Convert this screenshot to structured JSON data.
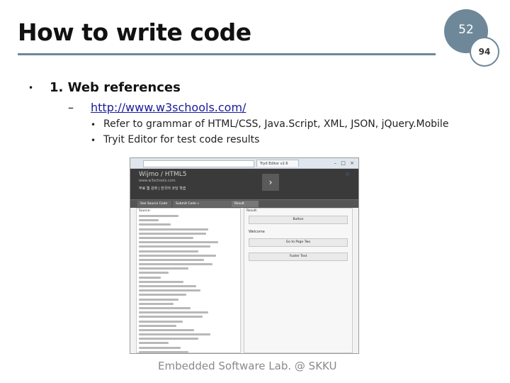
{
  "slide": {
    "title": "How to write code",
    "page_number": "52",
    "total_pages": "94",
    "footer": "Embedded Software Lab. @ SKKU"
  },
  "bullets": {
    "level1_marker": "•",
    "level1": "1. Web references",
    "level2_marker": "–",
    "level2_link": "http://www.w3schools.com/",
    "level3_marker": "•",
    "level3": [
      "Refer to grammar of HTML/CSS, Java.Script, XML, JSON, jQuery.Mobile",
      "Tryit Editor for test code results"
    ]
  },
  "screenshot": {
    "tab_label": "Tryit Editor v2.6",
    "window_controls": "– □ ×",
    "logo": "Wijmo / HTML5",
    "logo_sub": "www.w3schools.com",
    "ad_text": "무료 웹 강좌 | 한국어 코딩 학습",
    "next_arrow": "›",
    "ad_mark": "▷",
    "toolbar": [
      "See Source Code",
      "Submit Code »",
      "Result"
    ],
    "code_label": "Source:",
    "result_label": "Result:",
    "result_buttons": [
      "Button",
      "Go to Page Two",
      "Footer Text"
    ],
    "result_text": "Welcome"
  }
}
